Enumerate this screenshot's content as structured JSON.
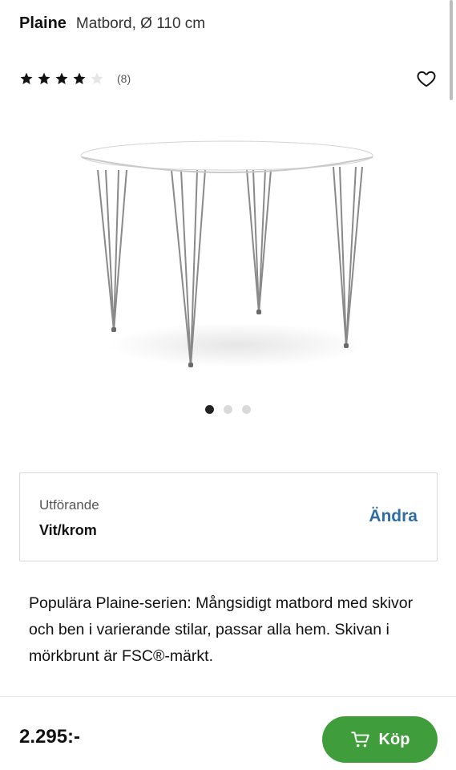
{
  "header": {
    "brand": "Plaine",
    "subtitle": "Matbord, Ø 110 cm"
  },
  "rating": {
    "stars_filled": 4,
    "stars_total": 5,
    "count": "(8)"
  },
  "gallery": {
    "images": 3,
    "active_index": 0
  },
  "variant": {
    "label": "Utförande",
    "value": "Vit/krom",
    "action": "Ändra"
  },
  "description": "Populära Plaine-serien: Mångsidigt matbord med skivor och ben i varierande stilar, passar alla hem. Skivan i mörkbrunt är FSC®-märkt.",
  "purchase": {
    "price": "2.295:-",
    "buy_label": "Köp"
  },
  "colors": {
    "accent_green": "#3f9e3b",
    "link_blue": "#2e6da4",
    "star": "#111111"
  },
  "icons": {
    "favorite": "heart-outline-icon",
    "cart": "cart-icon",
    "star": "star-icon"
  }
}
